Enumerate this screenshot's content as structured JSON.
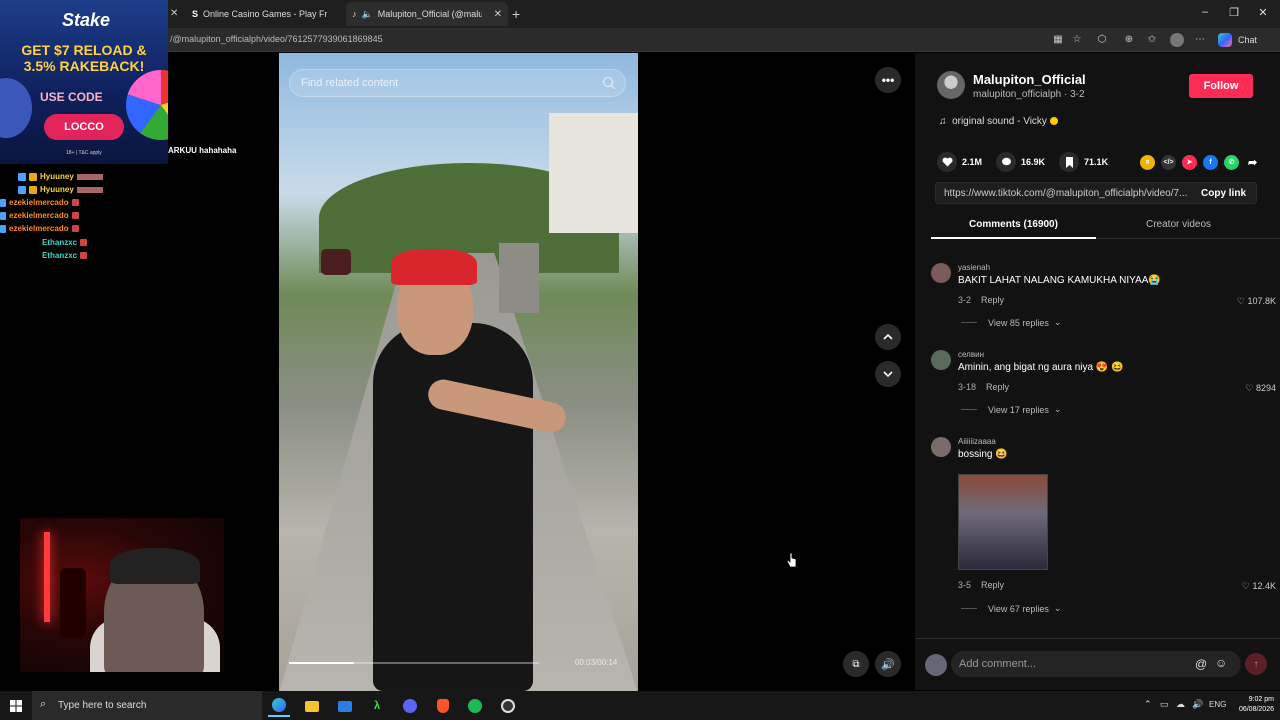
{
  "browser": {
    "tabs": [
      {
        "title": "Online Casino Games - Play Free N"
      },
      {
        "title": "Malupiton_Official (@malupit"
      }
    ],
    "url": "/@malupiton_officialph/video/7612577939061869845",
    "chat_label": "Chat"
  },
  "overlay": {
    "ad": {
      "logo": "Stake",
      "headline": "GET $7 RELOAD & 3.5% RAKEBACK!",
      "use_code": "USE CODE",
      "code": "LOCCO",
      "fine_print": "18+ | T&C apply"
    },
    "chat_line": "ARKUU hahahaha",
    "chat_names": [
      "Hyuuney",
      "Hyuuney",
      "ezekielmercado",
      "ezekielmercado",
      "ezekielmercado",
      "Ethanzxc",
      "Ethanzxc"
    ]
  },
  "video": {
    "search_placeholder": "Find related content",
    "time": "00:03/00:14",
    "progress": 0.26
  },
  "panel": {
    "username": "Malupiton_Official",
    "handle_date": "malupiton_officialph · 3-2",
    "follow_label": "Follow",
    "sound": "original sound - Vicky",
    "stats": {
      "likes": "2.1M",
      "comments": "16.9K",
      "saves": "71.1K"
    },
    "share_colors": [
      "#f0b400",
      "#333333",
      "#fe2c55",
      "#1877f2",
      "#25d366"
    ],
    "link": "https://www.tiktok.com/@malupiton_officialph/video/7...",
    "copy_label": "Copy link",
    "tabs": {
      "comments": "Comments (16900)",
      "creator": "Creator videos"
    },
    "comments": [
      {
        "name": "yasienah",
        "text": "BAKIT LAHAT NALANG KAMUKHA NIYAA😭",
        "date": "3-2",
        "reply": "Reply",
        "likes": "107.8K",
        "view_replies": "View 85 replies"
      },
      {
        "name": "селвин",
        "text": "Aminin, ang bigat ng aura niya 😍 😆",
        "date": "3-18",
        "reply": "Reply",
        "likes": "8294",
        "view_replies": "View 17 replies"
      },
      {
        "name": "Aiiiiiizaaaa",
        "text": "bossing 😆",
        "date": "3-5",
        "reply": "Reply",
        "likes": "12.4K",
        "view_replies": "View 67 replies"
      }
    ],
    "add_comment_placeholder": "Add comment..."
  },
  "taskbar": {
    "search_placeholder": "Type here to search",
    "lang": "ENG",
    "time": "9:02 pm",
    "date": "06/08/2026"
  },
  "colors": {
    "accent": "#fe2c55",
    "stake_blue": "#1d3d8a"
  }
}
